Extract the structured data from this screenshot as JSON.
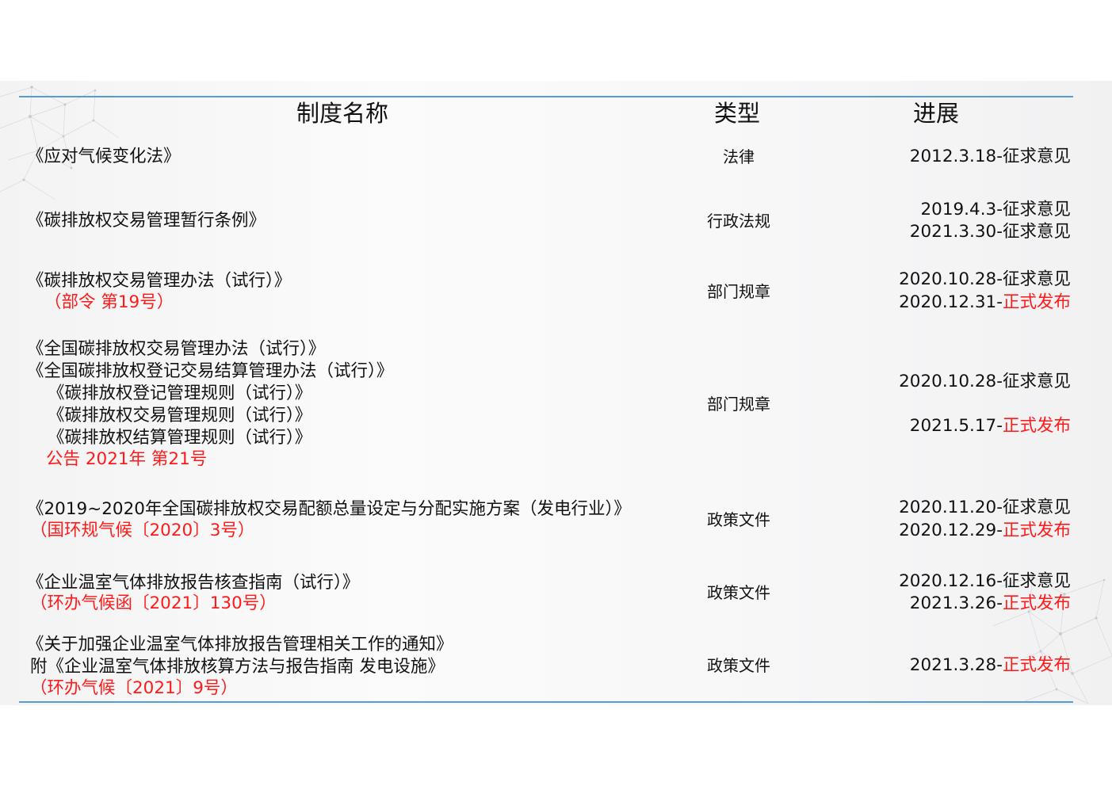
{
  "header": {
    "name_col": "制度名称",
    "type_col": "类型",
    "progress_col": "进展"
  },
  "rows": [
    {
      "names": [
        {
          "text": "《应对气候变化法》",
          "red": false
        }
      ],
      "type": "法律",
      "progress": [
        {
          "date": "2012.3.18-",
          "status": "征求意见",
          "red": false
        }
      ]
    },
    {
      "names": [
        {
          "text": "《碳排放权交易管理暂行条例》",
          "red": false
        }
      ],
      "type": "行政法规",
      "progress": [
        {
          "date": "2019.4.3-",
          "status": "征求意见",
          "red": false
        },
        {
          "date": "2021.3.30-",
          "status": "征求意见",
          "red": false
        }
      ]
    },
    {
      "names": [
        {
          "text": "《碳排放权交易管理办法（试行）》",
          "red": false
        },
        {
          "text": "（部令 第19号）",
          "red": true
        }
      ],
      "type": "部门规章",
      "progress": [
        {
          "date": "2020.10.28-",
          "status": "征求意见",
          "red": false
        },
        {
          "date": "2020.12.31-",
          "status": "正式发布",
          "red": true
        }
      ]
    },
    {
      "names": [
        {
          "text": "《全国碳排放权交易管理办法（试行）》",
          "red": false
        },
        {
          "text": "《全国碳排放权登记交易结算管理办法（试行）》",
          "red": false
        },
        {
          "text": "《碳排放权登记管理规则（试行）》",
          "red": false
        },
        {
          "text": "《碳排放权交易管理规则（试行）》",
          "red": false
        },
        {
          "text": "《碳排放权结算管理规则（试行）》",
          "red": false
        },
        {
          "text": "公告 2021年 第21号",
          "red": true
        }
      ],
      "type": "部门规章",
      "progress": [
        {
          "date": "2020.10.28-",
          "status": "征求意见",
          "red": false
        },
        {
          "date": "2021.5.17-",
          "status": "正式发布",
          "red": true
        }
      ]
    },
    {
      "names": [
        {
          "text": "《2019~2020年全国碳排放权交易配额总量设定与分配实施方案（发电行业）》",
          "red": false
        },
        {
          "text": "（国环规气候〔2020〕3号）",
          "red": true
        }
      ],
      "type": "政策文件",
      "progress": [
        {
          "date": "2020.11.20-",
          "status": "征求意见",
          "red": false
        },
        {
          "date": "2020.12.29-",
          "status": "正式发布",
          "red": true
        }
      ]
    },
    {
      "names": [
        {
          "text": "《企业温室气体排放报告核查指南（试行）》",
          "red": false
        },
        {
          "text": "（环办气候函〔2021〕130号）",
          "red": true
        }
      ],
      "type": "政策文件",
      "progress": [
        {
          "date": "2020.12.16-",
          "status": "征求意见",
          "red": false
        },
        {
          "date": "2021.3.26-",
          "status": "正式发布",
          "red": true
        }
      ]
    },
    {
      "names": [
        {
          "text": "《关于加强企业温室气体排放报告管理相关工作的通知》",
          "red": false
        },
        {
          "text": "附《企业温室气体排放核算方法与报告指南 发电设施》",
          "red": false
        },
        {
          "text": "（环办气候〔2021〕9号）",
          "red": true
        }
      ],
      "type": "政策文件",
      "progress": [
        {
          "date": "2021.3.28-",
          "status": "正式发布",
          "red": true
        }
      ]
    }
  ],
  "colors": {
    "accent_line": "#5b9bd5",
    "red": "#ff1a1a",
    "text": "#111111"
  }
}
